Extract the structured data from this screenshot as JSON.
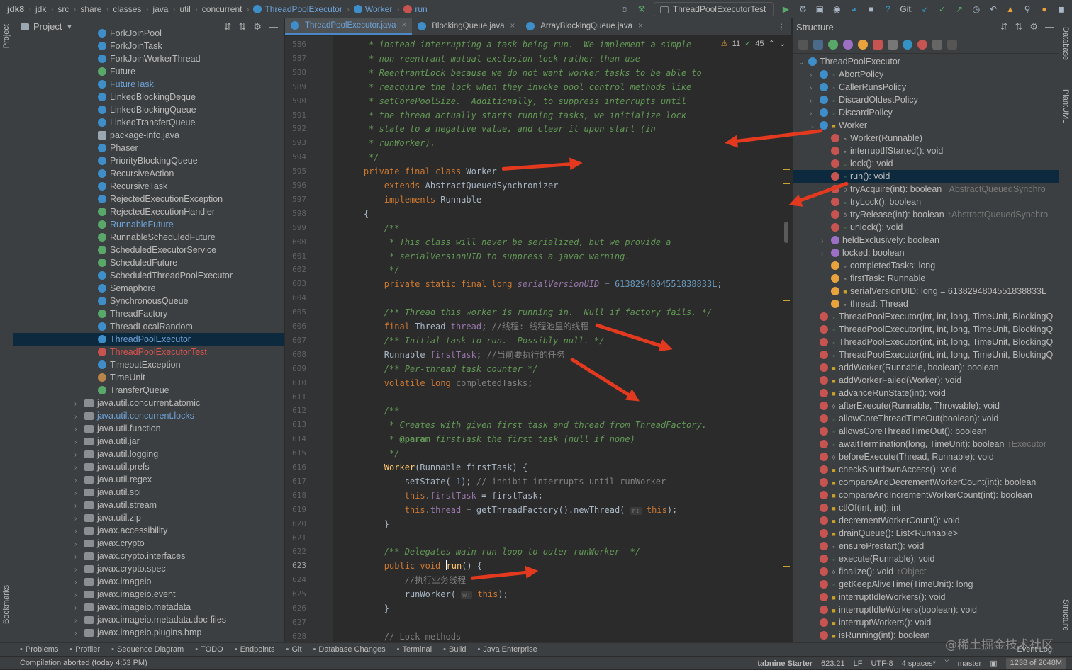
{
  "breadcrumb": [
    "jdk8",
    "jdk",
    "src",
    "share",
    "classes",
    "java",
    "util",
    "concurrent",
    "ThreadPoolExecutor",
    "Worker",
    "run"
  ],
  "toolbar": {
    "run_config": "ThreadPoolExecutorTest",
    "git_label": "Git:"
  },
  "left_strip": {
    "project": "Project",
    "bookmarks": "Bookmarks"
  },
  "right_strip": {
    "database": "Database",
    "plantuml": "PlantUML",
    "structure": "Structure"
  },
  "project": {
    "title": "Project",
    "items": [
      {
        "name": "ForkJoinPool",
        "type": "c"
      },
      {
        "name": "ForkJoinTask",
        "type": "c"
      },
      {
        "name": "ForkJoinWorkerThread",
        "type": "c"
      },
      {
        "name": "Future",
        "type": "i"
      },
      {
        "name": "FutureTask",
        "type": "c",
        "color": "#6ea3d8"
      },
      {
        "name": "LinkedBlockingDeque",
        "type": "c"
      },
      {
        "name": "LinkedBlockingQueue",
        "type": "c"
      },
      {
        "name": "LinkedTransferQueue",
        "type": "c"
      },
      {
        "name": "package-info.java",
        "type": "f"
      },
      {
        "name": "Phaser",
        "type": "c"
      },
      {
        "name": "PriorityBlockingQueue",
        "type": "c"
      },
      {
        "name": "RecursiveAction",
        "type": "c"
      },
      {
        "name": "RecursiveTask",
        "type": "c"
      },
      {
        "name": "RejectedExecutionException",
        "type": "c"
      },
      {
        "name": "RejectedExecutionHandler",
        "type": "i"
      },
      {
        "name": "RunnableFuture",
        "type": "i",
        "color": "#6ea3d8"
      },
      {
        "name": "RunnableScheduledFuture",
        "type": "i"
      },
      {
        "name": "ScheduledExecutorService",
        "type": "i"
      },
      {
        "name": "ScheduledFuture",
        "type": "i"
      },
      {
        "name": "ScheduledThreadPoolExecutor",
        "type": "c"
      },
      {
        "name": "Semaphore",
        "type": "c"
      },
      {
        "name": "SynchronousQueue",
        "type": "c"
      },
      {
        "name": "ThreadFactory",
        "type": "i"
      },
      {
        "name": "ThreadLocalRandom",
        "type": "c"
      },
      {
        "name": "ThreadPoolExecutor",
        "type": "c",
        "selected": true,
        "color": "#6ea3d8"
      },
      {
        "name": "ThreadPoolExecutorTest",
        "type": "t",
        "color": "#d9534f"
      },
      {
        "name": "TimeoutException",
        "type": "c"
      },
      {
        "name": "TimeUnit",
        "type": "e"
      },
      {
        "name": "TransferQueue",
        "type": "i"
      },
      {
        "name": "java.util.concurrent.atomic",
        "type": "pk"
      },
      {
        "name": "java.util.concurrent.locks",
        "type": "pk",
        "color": "#6ea3d8"
      },
      {
        "name": "java.util.function",
        "type": "pk"
      },
      {
        "name": "java.util.jar",
        "type": "pk"
      },
      {
        "name": "java.util.logging",
        "type": "pk"
      },
      {
        "name": "java.util.prefs",
        "type": "pk"
      },
      {
        "name": "java.util.regex",
        "type": "pk"
      },
      {
        "name": "java.util.spi",
        "type": "pk"
      },
      {
        "name": "java.util.stream",
        "type": "pk"
      },
      {
        "name": "java.util.zip",
        "type": "pk"
      },
      {
        "name": "javax.accessibility",
        "type": "pk"
      },
      {
        "name": "javax.crypto",
        "type": "pk"
      },
      {
        "name": "javax.crypto.interfaces",
        "type": "pk"
      },
      {
        "name": "javax.crypto.spec",
        "type": "pk"
      },
      {
        "name": "javax.imageio",
        "type": "pk"
      },
      {
        "name": "javax.imageio.event",
        "type": "pk"
      },
      {
        "name": "javax.imageio.metadata",
        "type": "pk"
      },
      {
        "name": "javax.imageio.metadata.doc-files",
        "type": "pk"
      },
      {
        "name": "javax.imageio.plugins.bmp",
        "type": "pk"
      }
    ]
  },
  "editor": {
    "tabs": [
      {
        "label": "ThreadPoolExecutor.java",
        "active": true
      },
      {
        "label": "BlockingQueue.java",
        "active": false
      },
      {
        "label": "ArrayBlockingQueue.java",
        "active": false
      }
    ],
    "warnings": "11",
    "ok": "45",
    "lines": [
      {
        "n": "586",
        "html": "<span class='cm'>     * instead interrupting a task being run.  We implement a simple</span>"
      },
      {
        "n": "587",
        "html": "<span class='cm'>     * non-reentrant mutual exclusion lock rather than use</span>"
      },
      {
        "n": "588",
        "html": "<span class='cm'>     * ReentrantLock because we do not want worker tasks to be able to</span>"
      },
      {
        "n": "589",
        "html": "<span class='cm'>     * reacquire the lock when they invoke pool control methods like</span>"
      },
      {
        "n": "590",
        "html": "<span class='cm'>     * setCorePoolSize.  Additionally, to suppress interrupts until</span>"
      },
      {
        "n": "591",
        "html": "<span class='cm'>     * the thread actually starts running tasks, we initialize lock</span>"
      },
      {
        "n": "592",
        "html": "<span class='cm'>     * state to a negative value, and clear it upon start (in</span>"
      },
      {
        "n": "593",
        "html": "<span class='cm'>     * runWorker).</span>"
      },
      {
        "n": "594",
        "html": "<span class='cm'>     */</span>"
      },
      {
        "n": "595",
        "html": "    <span class='kw'>private final class</span> Worker"
      },
      {
        "n": "596",
        "html": "        <span class='kw'>extends</span> AbstractQueuedSynchronizer"
      },
      {
        "n": "597",
        "html": "        <span class='kw'>implements</span> Runnable"
      },
      {
        "n": "598",
        "html": "    {"
      },
      {
        "n": "599",
        "html": "<span class='cm'>        /**</span>"
      },
      {
        "n": "600",
        "html": "<span class='cm'>         * This class will never be serialized, but we provide a</span>"
      },
      {
        "n": "601",
        "html": "<span class='cm'>         * serialVersionUID to suppress a javac warning.</span>"
      },
      {
        "n": "602",
        "html": "<span class='cm'>         */</span>"
      },
      {
        "n": "603",
        "html": "        <span class='kw'>private static final long</span> <span class='sfld'>serialVersionUID</span> = <span class='num'>6138294804551838833L</span>;"
      },
      {
        "n": "604",
        "html": ""
      },
      {
        "n": "605",
        "html": "<span class='cm'>        /** Thread this worker is running in.  Null if factory fails. */</span>"
      },
      {
        "n": "606",
        "html": "        <span class='kw'>final</span> Thread <span class='fld'>thread</span>; <span class='cs'>//线程: 线程池里的线程</span>"
      },
      {
        "n": "607",
        "html": "<span class='cm'>        /** Initial task to run.  Possibly null. */</span>"
      },
      {
        "n": "608",
        "html": "        Runnable <span class='fld'>firstTask</span>; <span class='cs'>//当前要执行的任务</span>"
      },
      {
        "n": "609",
        "html": "<span class='cm'>        /** Per-thread task counter */</span>"
      },
      {
        "n": "610",
        "html": "        <span class='kw'>volatile long</span> <span class='cn'>completedTasks</span>;"
      },
      {
        "n": "611",
        "html": ""
      },
      {
        "n": "612",
        "html": "<span class='cm'>        /**</span>"
      },
      {
        "n": "613",
        "html": "<span class='cm'>         * Creates with given first task and thread from ThreadFactory.</span>"
      },
      {
        "n": "614",
        "html": "<span class='cm'>         * </span><span class='tag'>@param</span><span class='cm'> firstTask the first task (null if none)</span>"
      },
      {
        "n": "615",
        "html": "<span class='cm'>         */</span>"
      },
      {
        "n": "616",
        "html": "        <span class='fn'>Worker</span>(Runnable firstTask) {"
      },
      {
        "n": "617",
        "html": "            setState(-<span class='num'>1</span>); <span class='cs'>// inhibit interrupts until runWorker</span>"
      },
      {
        "n": "618",
        "html": "            <span class='kw'>this</span>.<span class='fld'>firstTask</span> = firstTask;"
      },
      {
        "n": "619",
        "html": "            <span class='kw'>this</span>.<span class='fld'>thread</span> = getThreadFactory().newThread( <span class='hint'>r:</span> <span class='kw'>this</span>);"
      },
      {
        "n": "620",
        "html": "        }"
      },
      {
        "n": "621",
        "html": ""
      },
      {
        "n": "622",
        "html": "<span class='cm'>        /** Delegates main run loop to outer runWorker  */</span>"
      },
      {
        "n": "623",
        "html": "        <span class='kw'>public void</span> <span class='caret'></span><span class='fn'>run</span>() {"
      },
      {
        "n": "624",
        "html": "            <span class='cs'>//执行业务线程</span>"
      },
      {
        "n": "625",
        "html": "            runWorker( <span class='hint'>w:</span> <span class='kw'>this</span>);"
      },
      {
        "n": "626",
        "html": "        }"
      },
      {
        "n": "627",
        "html": ""
      },
      {
        "n": "628",
        "html": "        <span class='cs'>// Lock methods</span>"
      }
    ]
  },
  "structure": {
    "title": "Structure",
    "items": [
      {
        "label": "ThreadPoolExecutor",
        "ico": "cls",
        "indent": 0,
        "chev": "down"
      },
      {
        "label": "AbortPolicy",
        "ico": "cls",
        "indent": 1,
        "chev": "right",
        "vis": "pub"
      },
      {
        "label": "CallerRunsPolicy",
        "ico": "cls",
        "indent": 1,
        "chev": "right",
        "vis": "pub"
      },
      {
        "label": "DiscardOldestPolicy",
        "ico": "cls",
        "indent": 1,
        "chev": "right",
        "vis": "pub"
      },
      {
        "label": "DiscardPolicy",
        "ico": "cls",
        "indent": 1,
        "chev": "right",
        "vis": "pub"
      },
      {
        "label": "Worker",
        "ico": "cls",
        "indent": 1,
        "chev": "down",
        "vis": "lock"
      },
      {
        "label": "Worker(Runnable)",
        "ico": "m",
        "indent": 2,
        "vis": "pkg"
      },
      {
        "label": "interruptIfStarted(): void",
        "ico": "m",
        "indent": 2,
        "vis": "pkg"
      },
      {
        "label": "lock(): void",
        "ico": "m",
        "indent": 2,
        "vis": "pub"
      },
      {
        "label": "run(): void",
        "ico": "m",
        "indent": 2,
        "vis": "pub",
        "selected": true
      },
      {
        "label": "tryAcquire(int): boolean",
        "dim": "↑AbstractQueuedSynchro",
        "ico": "m",
        "indent": 2,
        "vis": "prot"
      },
      {
        "label": "tryLock(): boolean",
        "ico": "m",
        "indent": 2,
        "vis": "pub"
      },
      {
        "label": "tryRelease(int): boolean",
        "dim": "↑AbstractQueuedSynchro",
        "ico": "m",
        "indent": 2,
        "vis": "prot"
      },
      {
        "label": "unlock(): void",
        "ico": "m",
        "indent": 2,
        "vis": "pub"
      },
      {
        "label": "heldExclusively: boolean",
        "ico": "p",
        "indent": 2,
        "chev": "right"
      },
      {
        "label": "locked: boolean",
        "ico": "p",
        "indent": 2,
        "chev": "right"
      },
      {
        "label": "completedTasks: long",
        "ico": "fl",
        "indent": 2,
        "vis": "pkg"
      },
      {
        "label": "firstTask: Runnable",
        "ico": "fl",
        "indent": 2,
        "vis": "pkg"
      },
      {
        "label": "serialVersionUID: long = 6138294804551838833L",
        "ico": "fl",
        "indent": 2,
        "vis": "lock"
      },
      {
        "label": "thread: Thread",
        "ico": "fl",
        "indent": 2,
        "vis": "pkg"
      },
      {
        "label": "ThreadPoolExecutor(int, int, long, TimeUnit, BlockingQ",
        "ico": "m",
        "indent": 1,
        "vis": "pub"
      },
      {
        "label": "ThreadPoolExecutor(int, int, long, TimeUnit, BlockingQ",
        "ico": "m",
        "indent": 1,
        "vis": "pub"
      },
      {
        "label": "ThreadPoolExecutor(int, int, long, TimeUnit, BlockingQ",
        "ico": "m",
        "indent": 1,
        "vis": "pub"
      },
      {
        "label": "ThreadPoolExecutor(int, int, long, TimeUnit, BlockingQ",
        "ico": "m",
        "indent": 1,
        "vis": "pub"
      },
      {
        "label": "addWorker(Runnable, boolean): boolean",
        "ico": "m",
        "indent": 1,
        "vis": "lock"
      },
      {
        "label": "addWorkerFailed(Worker): void",
        "ico": "m",
        "indent": 1,
        "vis": "lock"
      },
      {
        "label": "advanceRunState(int): void",
        "ico": "m",
        "indent": 1,
        "vis": "lock"
      },
      {
        "label": "afterExecute(Runnable, Throwable): void",
        "ico": "m",
        "indent": 1,
        "vis": "prot"
      },
      {
        "label": "allowCoreThreadTimeOut(boolean): void",
        "ico": "m",
        "indent": 1,
        "vis": "pub"
      },
      {
        "label": "allowsCoreThreadTimeOut(): boolean",
        "ico": "m",
        "indent": 1,
        "vis": "pub"
      },
      {
        "label": "awaitTermination(long, TimeUnit): boolean",
        "dim": "↑Executor",
        "ico": "m",
        "indent": 1,
        "vis": "pub"
      },
      {
        "label": "beforeExecute(Thread, Runnable): void",
        "ico": "m",
        "indent": 1,
        "vis": "prot"
      },
      {
        "label": "checkShutdownAccess(): void",
        "ico": "m",
        "indent": 1,
        "vis": "lock"
      },
      {
        "label": "compareAndDecrementWorkerCount(int): boolean",
        "ico": "m",
        "indent": 1,
        "vis": "lock"
      },
      {
        "label": "compareAndIncrementWorkerCount(int): boolean",
        "ico": "m",
        "indent": 1,
        "vis": "lock"
      },
      {
        "label": "ctlOf(int, int): int",
        "ico": "m",
        "indent": 1,
        "vis": "lock"
      },
      {
        "label": "decrementWorkerCount(): void",
        "ico": "m",
        "indent": 1,
        "vis": "lock"
      },
      {
        "label": "drainQueue(): List<Runnable>",
        "ico": "m",
        "indent": 1,
        "vis": "lock"
      },
      {
        "label": "ensurePrestart(): void",
        "ico": "m",
        "indent": 1,
        "vis": "pkg"
      },
      {
        "label": "execute(Runnable): void",
        "ico": "m",
        "indent": 1,
        "vis": "pub"
      },
      {
        "label": "finalize(): void",
        "dim": "↑Object",
        "ico": "m",
        "indent": 1,
        "vis": "prot"
      },
      {
        "label": "getKeepAliveTime(TimeUnit): long",
        "ico": "m",
        "indent": 1,
        "vis": "pub"
      },
      {
        "label": "interruptIdleWorkers(): void",
        "ico": "m",
        "indent": 1,
        "vis": "lock"
      },
      {
        "label": "interruptIdleWorkers(boolean): void",
        "ico": "m",
        "indent": 1,
        "vis": "lock"
      },
      {
        "label": "interruptWorkers(): void",
        "ico": "m",
        "indent": 1,
        "vis": "lock"
      },
      {
        "label": "isRunning(int): boolean",
        "ico": "m",
        "indent": 1,
        "vis": "lock"
      }
    ]
  },
  "bottom_tools": [
    "Problems",
    "Profiler",
    "Sequence Diagram",
    "TODO",
    "Endpoints",
    "Git",
    "Database Changes",
    "Terminal",
    "Build",
    "Java Enterprise"
  ],
  "status": {
    "message": "Compilation aborted (today 4:53 PM)",
    "tabnine": "tabnine Starter",
    "position": "623:21",
    "line_sep": "LF",
    "encoding": "UTF-8",
    "indent": "4 spaces*",
    "branch": "master",
    "memory": "1238 of 2048M",
    "event_log": "Event Log"
  },
  "watermark": "@稀土掘金技术社区",
  "colors": {
    "arrow": "#e33a1f",
    "accent": "#4a88c7"
  }
}
